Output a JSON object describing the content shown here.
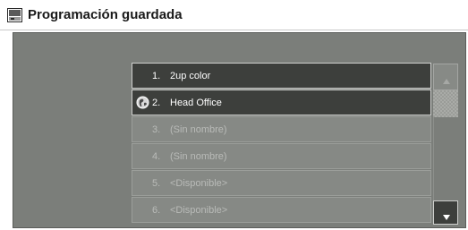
{
  "window": {
    "title": "Programación guardada",
    "title_icon": "saved-program-icon"
  },
  "list": {
    "items": [
      {
        "number": "1.",
        "label": "2up color",
        "state": "named",
        "icon": null
      },
      {
        "number": "2.",
        "label": "Head Office",
        "state": "named",
        "icon": "globe-icon"
      },
      {
        "number": "3.",
        "label": "(Sin nombre)",
        "state": "empty",
        "icon": null
      },
      {
        "number": "4.",
        "label": "(Sin nombre)",
        "state": "empty",
        "icon": null
      },
      {
        "number": "5.",
        "label": "<Disponible>",
        "state": "empty",
        "icon": null
      },
      {
        "number": "6.",
        "label": "<Disponible>",
        "state": "empty",
        "icon": null
      }
    ]
  },
  "scrollbar": {
    "up_icon": "scroll-up-arrow-icon",
    "down_icon": "scroll-down-arrow-icon",
    "up_enabled": false,
    "down_enabled": true
  },
  "colors": {
    "panel": "#7b7e7a",
    "item_selected": "#3d3f3c",
    "item_empty": "#868985"
  }
}
